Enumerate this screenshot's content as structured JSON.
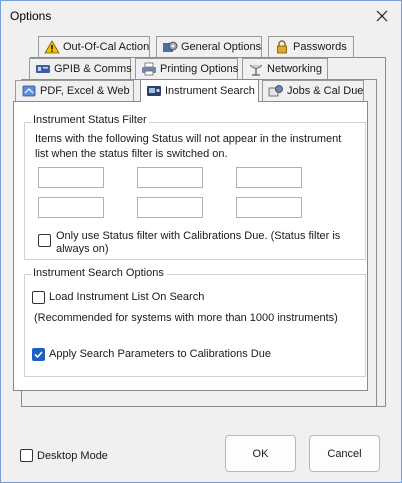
{
  "window": {
    "title": "Options"
  },
  "tabs": {
    "row1": [
      {
        "label": "Out-Of-Cal Action",
        "icon": "warning-icon"
      },
      {
        "label": "General Options",
        "icon": "settings-icon"
      },
      {
        "label": "Passwords",
        "icon": "lock-icon"
      }
    ],
    "row2": [
      {
        "label": "GPIB & Comms",
        "icon": "network-card-icon"
      },
      {
        "label": "Printing Options",
        "icon": "printer-icon"
      },
      {
        "label": "Networking",
        "icon": "satellite-dish-icon"
      }
    ],
    "row3": [
      {
        "label": "PDF, Excel & Web",
        "icon": "export-icon"
      },
      {
        "label": "Instrument Search",
        "icon": "instrument-icon",
        "active": true
      },
      {
        "label": "Jobs & Cal Due",
        "icon": "jobs-icon"
      }
    ]
  },
  "status_filter": {
    "title": "Instrument Status Filter",
    "description_line1": "Items with the following Status will not appear in the instrument",
    "description_line2": "list when the status filter is switched on.",
    "inputs": [
      "",
      "",
      "",
      "",
      "",
      ""
    ],
    "only_cal_due_line1": "Only use Status filter with Calibrations Due. (Status filter is",
    "only_cal_due_line2": "always on)",
    "only_cal_due_checked": false
  },
  "search_options": {
    "title": "Instrument Search Options",
    "load_on_search": "Load Instrument List On Search",
    "load_on_search_checked": false,
    "recommendation": "(Recommended for systems with more than 1000 instruments)",
    "apply_params": "Apply Search Parameters to Calibrations Due",
    "apply_params_checked": true
  },
  "footer": {
    "desktop_mode": "Desktop Mode",
    "desktop_mode_checked": false,
    "ok": "OK",
    "cancel": "Cancel"
  },
  "colors": {
    "accent": "#1f5fc2",
    "window_border": "#7a9ed6"
  }
}
